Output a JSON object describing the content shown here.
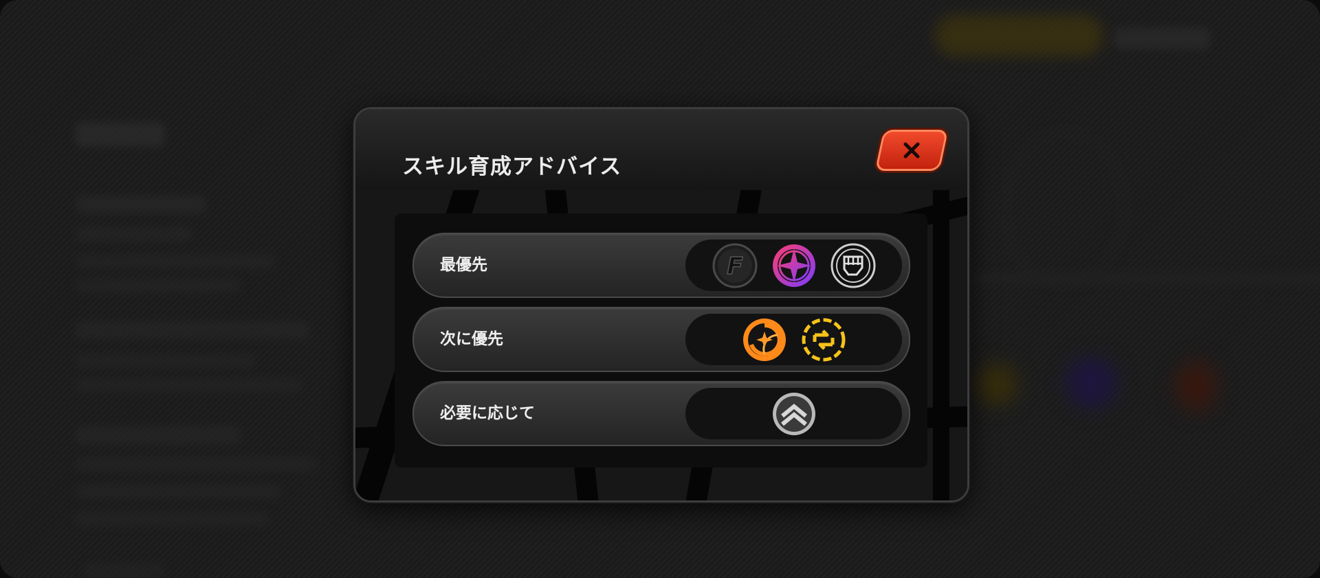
{
  "modal": {
    "title": "スキル育成アドバイス"
  },
  "rows": [
    {
      "label": "最優先",
      "icons": [
        "basic-attack-icon",
        "special-attack-icon",
        "core-skill-icon"
      ]
    },
    {
      "label": "次に優先",
      "icons": [
        "ultimate-icon",
        "assist-icon"
      ]
    },
    {
      "label": "必要に応じて",
      "icons": [
        "dodge-icon"
      ]
    }
  ],
  "colors": {
    "close_button": "#e0301a",
    "special_icon_gradient": [
      "#ff3d6e",
      "#7a3cff"
    ],
    "ultimate_icon": "#ff8a1a",
    "assist_icon": "#f7c21a",
    "dodge_icon": "#b9b9b9"
  }
}
